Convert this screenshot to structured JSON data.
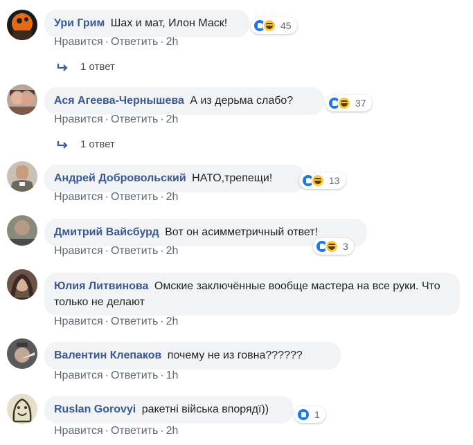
{
  "actions": {
    "like": "Нравится",
    "reply": "Ответить",
    "sep": "·"
  },
  "comments": [
    {
      "author": "Ури Грим",
      "text": "Шах и мат, Илон Маск!",
      "count": "45",
      "time": "2h",
      "replies": "1 ответ",
      "reactions": [
        "like",
        "haha"
      ]
    },
    {
      "author": "Ася Агеева-Чернышева",
      "text": "А из дерьма слабо?",
      "count": "37",
      "time": "2h",
      "replies": "1 ответ",
      "reactions": [
        "like",
        "haha"
      ]
    },
    {
      "author": "Андрей Добровольский",
      "text": "НАТО,трепещи!",
      "count": "13",
      "time": "2h",
      "reactions": [
        "like",
        "haha"
      ]
    },
    {
      "author": "Дмитрий Вайсбурд",
      "text": "Вот он асимметричный ответ!",
      "count": "3",
      "time": "2h",
      "reactions": [
        "like",
        "haha"
      ]
    },
    {
      "author": "Юлия Литвинова",
      "text": "Омские заключённые вообще мастера на все руки. Что только не делают",
      "time": "2h"
    },
    {
      "author": "Валентин Клепаков",
      "text": "почему не из говна??????",
      "time": "1h"
    },
    {
      "author": "Ruslan Gorovyi",
      "text": "ракетні війська впорядї))",
      "count": "1",
      "time": "2h",
      "reactions": [
        "like"
      ]
    }
  ],
  "colors": {
    "author": "#385898",
    "bubble": "#f2f3f5",
    "like": "#1877f2",
    "haha": "#f7c93b",
    "meta": "#606770"
  }
}
